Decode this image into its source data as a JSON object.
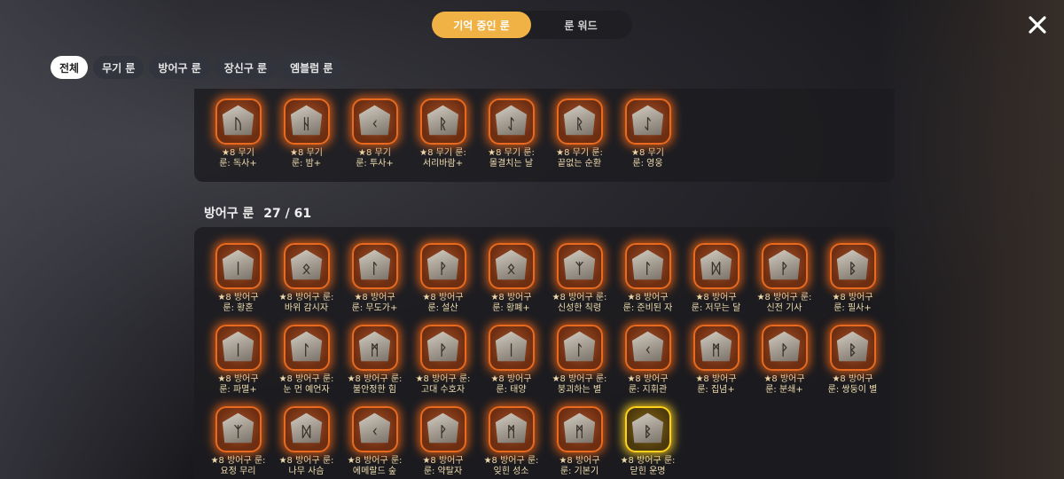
{
  "top_tabs": [
    {
      "label": "기억 중인 룬",
      "active": true
    },
    {
      "label": "룬 워드",
      "active": false
    }
  ],
  "filters": [
    {
      "label": "전체",
      "active": true
    },
    {
      "label": "무기 룬",
      "active": false
    },
    {
      "label": "방어구 룬",
      "active": false
    },
    {
      "label": "장신구 룬",
      "active": false
    },
    {
      "label": "엠블럼 룬",
      "active": false
    }
  ],
  "weapon_runes": [
    {
      "line1": "★8 무기",
      "line2": "룬: 독사+",
      "glyph": "ᚢ"
    },
    {
      "line1": "★8 무기",
      "line2": "룬: 밤+",
      "glyph": "ᚺ"
    },
    {
      "line1": "★8 무기",
      "line2": "룬: 투사+",
      "glyph": "ᚲ"
    },
    {
      "line1": "★8 무기 룬:",
      "line2": "서리바람+",
      "glyph": "ᚱ"
    },
    {
      "line1": "★8 무기 룬:",
      "line2": "몰결치는 날",
      "glyph": "ᛇ"
    },
    {
      "line1": "★8 무기 룬:",
      "line2": "끝없는 순환",
      "glyph": "ᚱ"
    },
    {
      "line1": "★8 무기",
      "line2": "룬: 영웅",
      "glyph": "ᛇ"
    }
  ],
  "armor_section": {
    "title": "방어구 룬",
    "count": "27 / 61"
  },
  "armor_runes": [
    {
      "line1": "★8 방어구",
      "line2": "룬: 황혼",
      "glyph": "ᛁ",
      "gold": false
    },
    {
      "line1": "★8 방어구 룬:",
      "line2": "바위 감시자",
      "glyph": "ᛟ",
      "gold": false
    },
    {
      "line1": "★8 방어구",
      "line2": "룬: 무도가+",
      "glyph": "ᛚ",
      "gold": false
    },
    {
      "line1": "★8 방어구",
      "line2": "룬: 설산",
      "glyph": "ᚹ",
      "gold": false
    },
    {
      "line1": "★8 방어구",
      "line2": "룬: 황폐+",
      "glyph": "ᛟ",
      "gold": false
    },
    {
      "line1": "★8 방어구 룬:",
      "line2": "신성한 칙령",
      "glyph": "ᛉ",
      "gold": false
    },
    {
      "line1": "★8 방어구",
      "line2": "룬: 준비된 자",
      "glyph": "ᛚ",
      "gold": false
    },
    {
      "line1": "★8 방어구",
      "line2": "룬: 저무는 달",
      "glyph": "ᛞ",
      "gold": false
    },
    {
      "line1": "★8 방어구 룬:",
      "line2": "신전 기사",
      "glyph": "ᚹ",
      "gold": false
    },
    {
      "line1": "★8 방어구",
      "line2": "룬: 필사+",
      "glyph": "ᛒ",
      "gold": false
    },
    {
      "line1": "★8 방어구",
      "line2": "룬: 파멸+",
      "glyph": "ᛁ",
      "gold": false
    },
    {
      "line1": "★8 방어구 룬:",
      "line2": "눈 먼 예언자",
      "glyph": "ᛚ",
      "gold": false
    },
    {
      "line1": "★8 방어구 룬:",
      "line2": "불안정한 힘",
      "glyph": "ᛗ",
      "gold": false
    },
    {
      "line1": "★8 방어구 룬:",
      "line2": "고대 수호자",
      "glyph": "ᚹ",
      "gold": false
    },
    {
      "line1": "★8 방어구",
      "line2": "룬: 태양",
      "glyph": "ᛁ",
      "gold": false
    },
    {
      "line1": "★8 방어구 룬:",
      "line2": "붕괴하는 별",
      "glyph": "ᛚ",
      "gold": false
    },
    {
      "line1": "★8 방어구",
      "line2": "룬: 지휘관",
      "glyph": "ᚲ",
      "gold": false
    },
    {
      "line1": "★8 방어구",
      "line2": "룬: 집념+",
      "glyph": "ᛗ",
      "gold": false
    },
    {
      "line1": "★8 방어구",
      "line2": "룬: 분쇄+",
      "glyph": "ᚹ",
      "gold": false
    },
    {
      "line1": "★8 방어구",
      "line2": "룬: 쌍둥이 별",
      "glyph": "ᛒ",
      "gold": false
    },
    {
      "line1": "★8 방어구 룬:",
      "line2": "요정 무리",
      "glyph": "ᛉ",
      "gold": false
    },
    {
      "line1": "★8 방어구 룬:",
      "line2": "나무 사슴",
      "glyph": "ᛞ",
      "gold": false
    },
    {
      "line1": "★8 방어구 룬:",
      "line2": "에메랄드 숲",
      "glyph": "ᚲ",
      "gold": false
    },
    {
      "line1": "★8 방어구",
      "line2": "룬: 약탈자",
      "glyph": "ᚹ",
      "gold": false
    },
    {
      "line1": "★8 방어구 룬:",
      "line2": "잊힌 성소",
      "glyph": "ᛗ",
      "gold": false
    },
    {
      "line1": "★8 방어구",
      "line2": "룬: 기본기",
      "glyph": "ᛗ",
      "gold": false
    },
    {
      "line1": "★8 방어구 룬:",
      "line2": "닫힌 운명",
      "glyph": "ᛒ",
      "gold": true
    }
  ]
}
